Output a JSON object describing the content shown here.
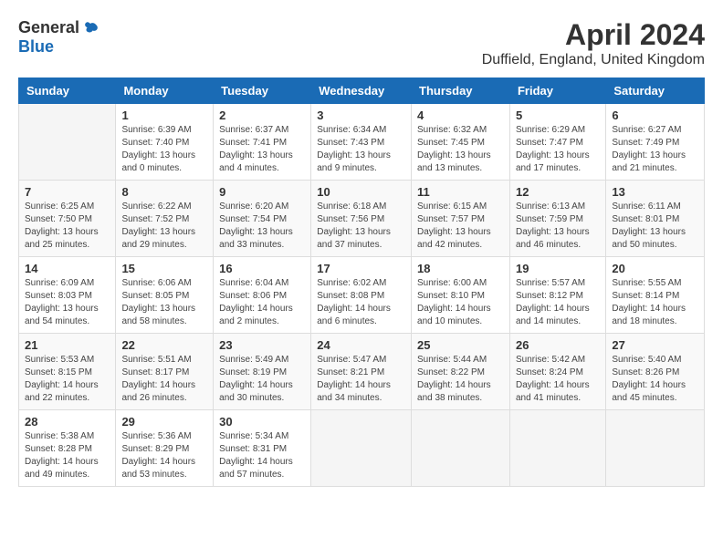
{
  "header": {
    "logo_general": "General",
    "logo_blue": "Blue",
    "title": "April 2024",
    "location": "Duffield, England, United Kingdom"
  },
  "days_of_week": [
    "Sunday",
    "Monday",
    "Tuesday",
    "Wednesday",
    "Thursday",
    "Friday",
    "Saturday"
  ],
  "weeks": [
    [
      {
        "day": "",
        "info": ""
      },
      {
        "day": "1",
        "info": "Sunrise: 6:39 AM\nSunset: 7:40 PM\nDaylight: 13 hours\nand 0 minutes."
      },
      {
        "day": "2",
        "info": "Sunrise: 6:37 AM\nSunset: 7:41 PM\nDaylight: 13 hours\nand 4 minutes."
      },
      {
        "day": "3",
        "info": "Sunrise: 6:34 AM\nSunset: 7:43 PM\nDaylight: 13 hours\nand 9 minutes."
      },
      {
        "day": "4",
        "info": "Sunrise: 6:32 AM\nSunset: 7:45 PM\nDaylight: 13 hours\nand 13 minutes."
      },
      {
        "day": "5",
        "info": "Sunrise: 6:29 AM\nSunset: 7:47 PM\nDaylight: 13 hours\nand 17 minutes."
      },
      {
        "day": "6",
        "info": "Sunrise: 6:27 AM\nSunset: 7:49 PM\nDaylight: 13 hours\nand 21 minutes."
      }
    ],
    [
      {
        "day": "7",
        "info": "Sunrise: 6:25 AM\nSunset: 7:50 PM\nDaylight: 13 hours\nand 25 minutes."
      },
      {
        "day": "8",
        "info": "Sunrise: 6:22 AM\nSunset: 7:52 PM\nDaylight: 13 hours\nand 29 minutes."
      },
      {
        "day": "9",
        "info": "Sunrise: 6:20 AM\nSunset: 7:54 PM\nDaylight: 13 hours\nand 33 minutes."
      },
      {
        "day": "10",
        "info": "Sunrise: 6:18 AM\nSunset: 7:56 PM\nDaylight: 13 hours\nand 37 minutes."
      },
      {
        "day": "11",
        "info": "Sunrise: 6:15 AM\nSunset: 7:57 PM\nDaylight: 13 hours\nand 42 minutes."
      },
      {
        "day": "12",
        "info": "Sunrise: 6:13 AM\nSunset: 7:59 PM\nDaylight: 13 hours\nand 46 minutes."
      },
      {
        "day": "13",
        "info": "Sunrise: 6:11 AM\nSunset: 8:01 PM\nDaylight: 13 hours\nand 50 minutes."
      }
    ],
    [
      {
        "day": "14",
        "info": "Sunrise: 6:09 AM\nSunset: 8:03 PM\nDaylight: 13 hours\nand 54 minutes."
      },
      {
        "day": "15",
        "info": "Sunrise: 6:06 AM\nSunset: 8:05 PM\nDaylight: 13 hours\nand 58 minutes."
      },
      {
        "day": "16",
        "info": "Sunrise: 6:04 AM\nSunset: 8:06 PM\nDaylight: 14 hours\nand 2 minutes."
      },
      {
        "day": "17",
        "info": "Sunrise: 6:02 AM\nSunset: 8:08 PM\nDaylight: 14 hours\nand 6 minutes."
      },
      {
        "day": "18",
        "info": "Sunrise: 6:00 AM\nSunset: 8:10 PM\nDaylight: 14 hours\nand 10 minutes."
      },
      {
        "day": "19",
        "info": "Sunrise: 5:57 AM\nSunset: 8:12 PM\nDaylight: 14 hours\nand 14 minutes."
      },
      {
        "day": "20",
        "info": "Sunrise: 5:55 AM\nSunset: 8:14 PM\nDaylight: 14 hours\nand 18 minutes."
      }
    ],
    [
      {
        "day": "21",
        "info": "Sunrise: 5:53 AM\nSunset: 8:15 PM\nDaylight: 14 hours\nand 22 minutes."
      },
      {
        "day": "22",
        "info": "Sunrise: 5:51 AM\nSunset: 8:17 PM\nDaylight: 14 hours\nand 26 minutes."
      },
      {
        "day": "23",
        "info": "Sunrise: 5:49 AM\nSunset: 8:19 PM\nDaylight: 14 hours\nand 30 minutes."
      },
      {
        "day": "24",
        "info": "Sunrise: 5:47 AM\nSunset: 8:21 PM\nDaylight: 14 hours\nand 34 minutes."
      },
      {
        "day": "25",
        "info": "Sunrise: 5:44 AM\nSunset: 8:22 PM\nDaylight: 14 hours\nand 38 minutes."
      },
      {
        "day": "26",
        "info": "Sunrise: 5:42 AM\nSunset: 8:24 PM\nDaylight: 14 hours\nand 41 minutes."
      },
      {
        "day": "27",
        "info": "Sunrise: 5:40 AM\nSunset: 8:26 PM\nDaylight: 14 hours\nand 45 minutes."
      }
    ],
    [
      {
        "day": "28",
        "info": "Sunrise: 5:38 AM\nSunset: 8:28 PM\nDaylight: 14 hours\nand 49 minutes."
      },
      {
        "day": "29",
        "info": "Sunrise: 5:36 AM\nSunset: 8:29 PM\nDaylight: 14 hours\nand 53 minutes."
      },
      {
        "day": "30",
        "info": "Sunrise: 5:34 AM\nSunset: 8:31 PM\nDaylight: 14 hours\nand 57 minutes."
      },
      {
        "day": "",
        "info": ""
      },
      {
        "day": "",
        "info": ""
      },
      {
        "day": "",
        "info": ""
      },
      {
        "day": "",
        "info": ""
      }
    ]
  ]
}
